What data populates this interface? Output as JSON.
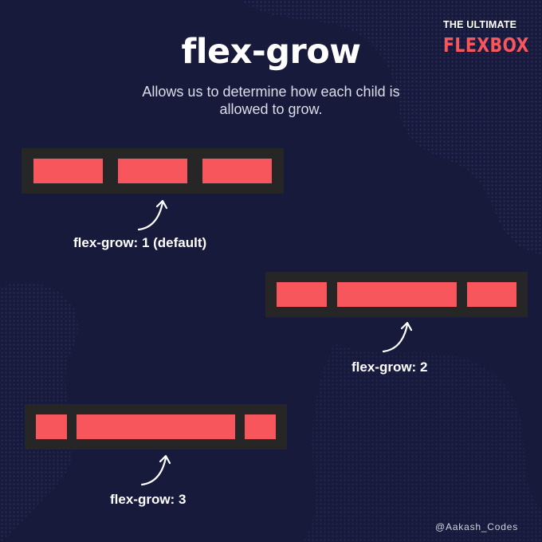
{
  "brand": {
    "top": "THE ULTIMATE",
    "main": "FLEXBOX",
    "accent": "#f6565c"
  },
  "title": "flex-grow",
  "subtitle": "Allows us to determine how each child is allowed to grow.",
  "examples": [
    {
      "label": "flex-grow: 1 (default)",
      "grow_values": [
        1,
        1,
        1
      ]
    },
    {
      "label": "flex-grow: 2",
      "grow_values": [
        1,
        2,
        1
      ]
    },
    {
      "label": "flex-grow: 3",
      "grow_values": [
        1,
        3,
        1
      ]
    }
  ],
  "handle": "@Aakash_Codes",
  "colors": {
    "background": "#181a3b",
    "container": "#262626",
    "item": "#f6565c"
  },
  "icons": {
    "pointer": "curved-arrow-icon"
  }
}
